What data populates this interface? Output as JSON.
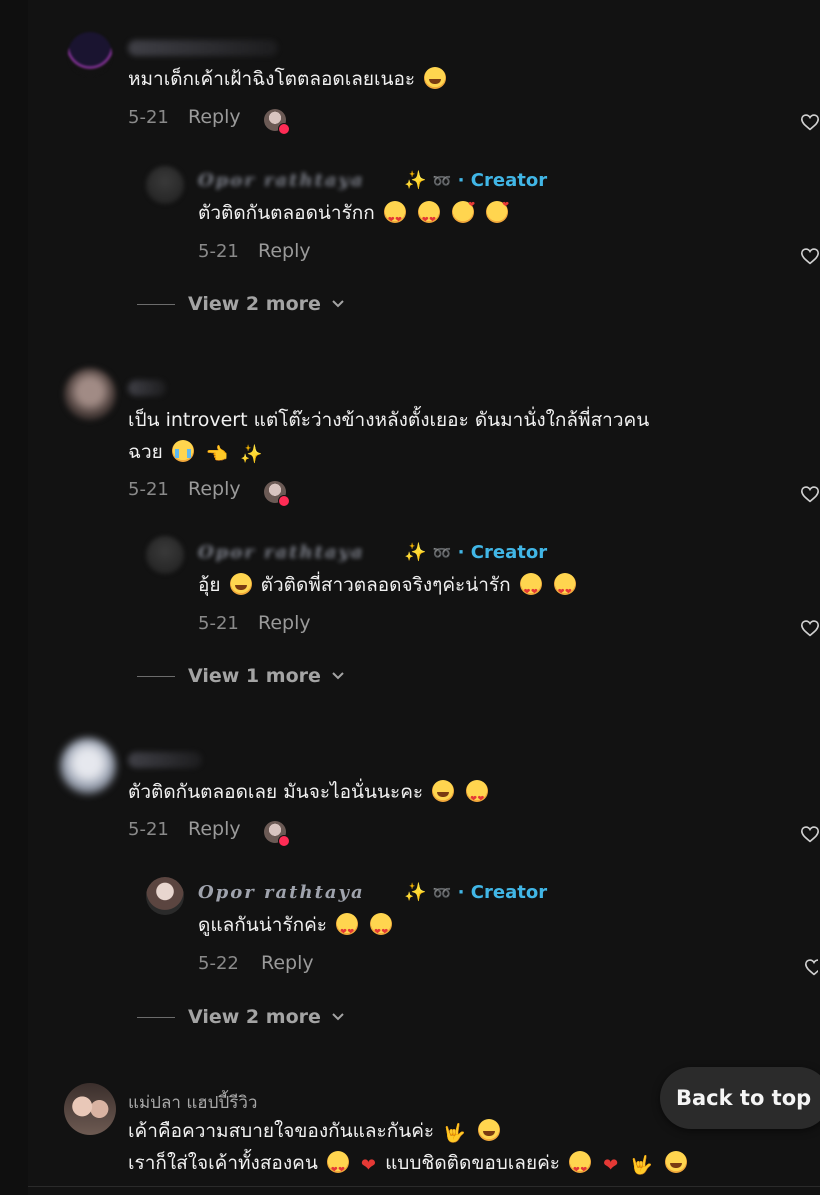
{
  "comments": [
    {
      "text": "หมาเด็กเค้าเฝ้าฉิงโตตลอดเลยเนอะ",
      "date": "5-21",
      "reply_label": "Reply",
      "reply": {
        "author": "Opor rathtaya",
        "creator_badge": "· Creator",
        "text": "ตัวติดกันตลอดน่ารักก",
        "date": "5-21",
        "reply_label": "Reply"
      },
      "view_more": "View 2 more"
    },
    {
      "text_line1": "เป็น introvert แต่โต๊ะว่างข้างหลังตั้งเยอะ ดันมานั่งใกล้พี่สาวคน",
      "text_line2": "ฉวย",
      "date": "5-21",
      "reply_label": "Reply",
      "reply": {
        "author": "Opor rathtaya",
        "creator_badge": "· Creator",
        "text_before": "อุ้ย",
        "text_after": "ตัวติดพี่สาวตลอดจริงๆค่ะน่ารัก",
        "date": "5-21",
        "reply_label": "Reply"
      },
      "view_more": "View 1 more"
    },
    {
      "text": "ตัวติดกันตลอดเลย มันจะไอนั่นนะคะ",
      "date": "5-21",
      "reply_label": "Reply",
      "reply": {
        "author": "Opor rathtaya",
        "creator_badge": "· Creator",
        "text": "ดูแลกันน่ารักค่ะ",
        "date": "5-22",
        "reply_label": "Reply"
      },
      "view_more": "View 2 more"
    },
    {
      "author": "แม่ปลา แฮปปี้รีวิว",
      "text_line1": "เค้าคือความสบายใจของกันและกันค่ะ",
      "text_line2_a": "เราก็ใส่ใจเค้าทั้งสองคน",
      "text_line2_b": "แบบชิดติดขอบเลยค่ะ"
    }
  ],
  "back_to_top": "Back to top",
  "icons": {
    "like": "heart-outline-icon",
    "chevron": "chevron-down-icon",
    "badge_sparkle": "sparkles-icon",
    "badge_loop": "loop-icon"
  },
  "colors": {
    "background": "#121212",
    "creator_accent": "#41b6e6",
    "like_badge": "#fe2c55"
  }
}
